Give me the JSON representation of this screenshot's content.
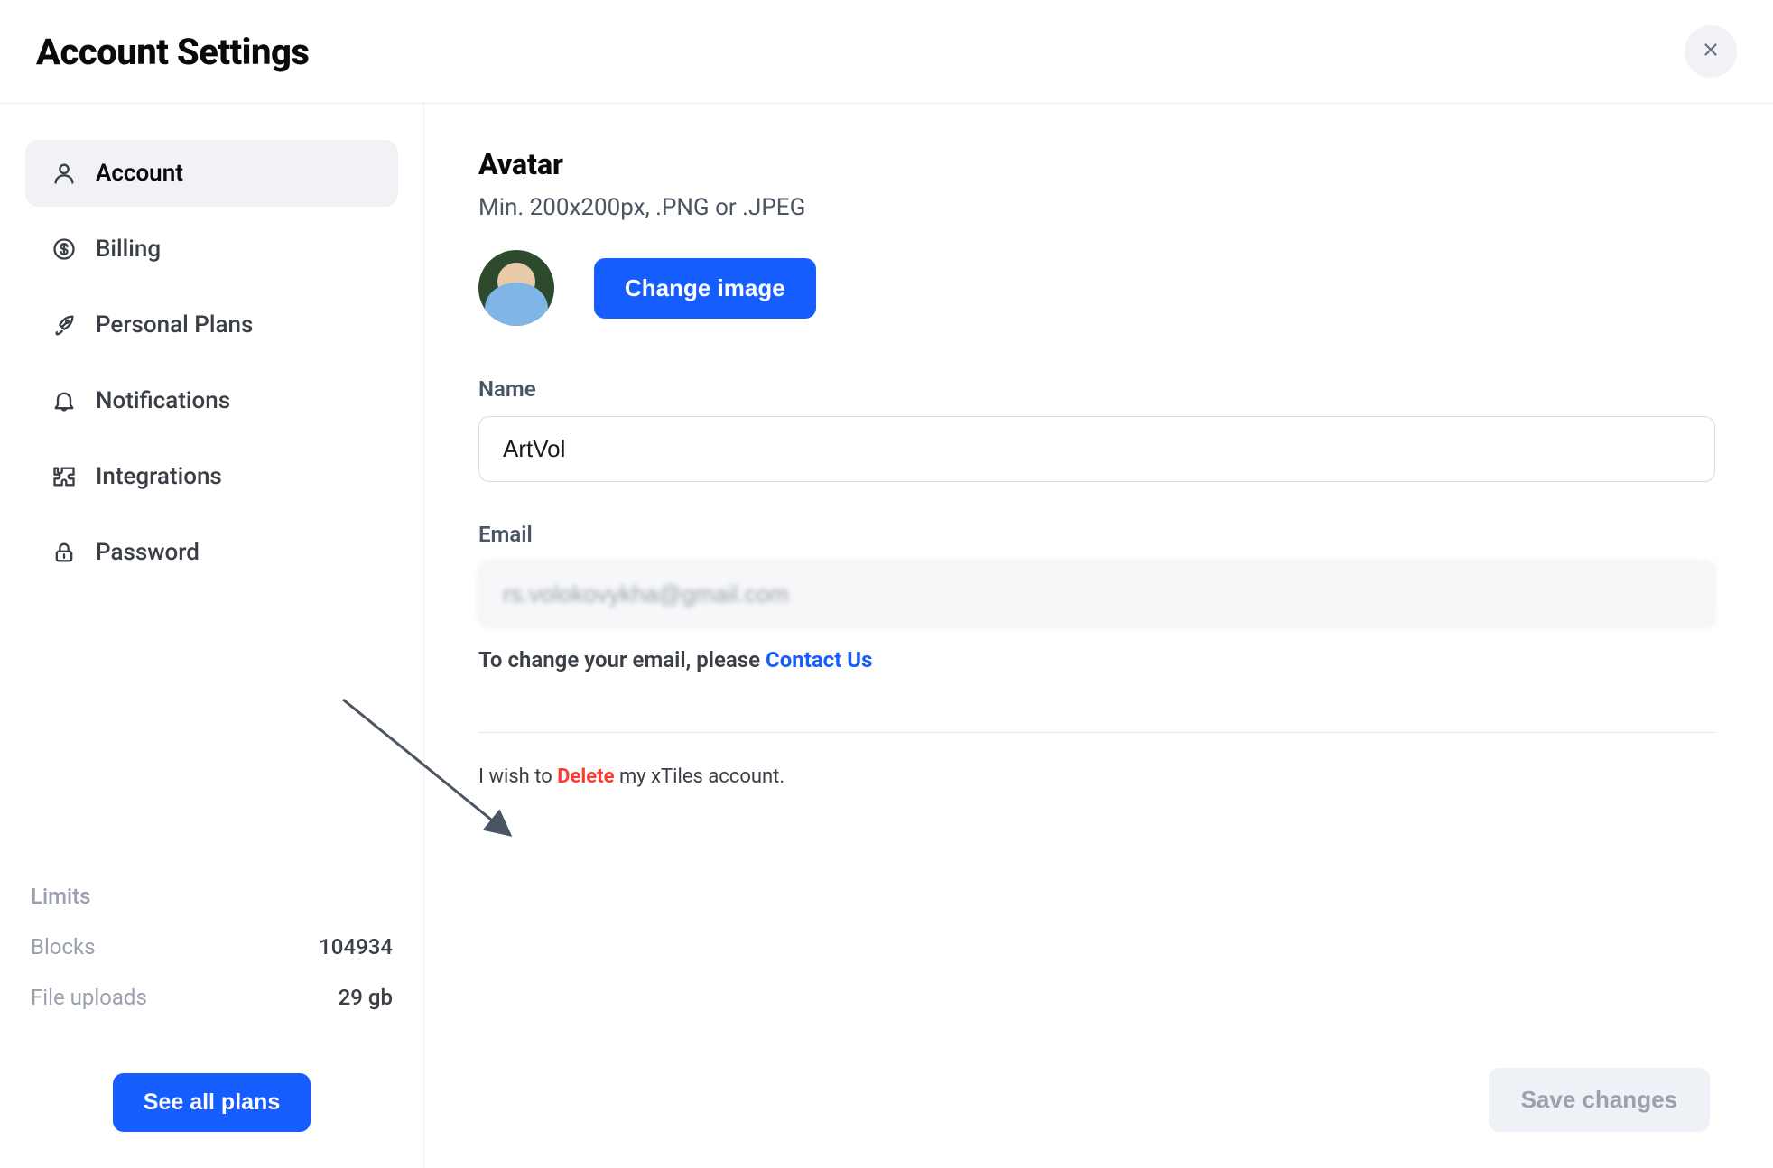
{
  "header": {
    "title": "Account Settings"
  },
  "sidebar": {
    "items": [
      {
        "label": "Account",
        "icon": "user-icon",
        "active": true
      },
      {
        "label": "Billing",
        "icon": "dollar-icon",
        "active": false
      },
      {
        "label": "Personal Plans",
        "icon": "rocket-icon",
        "active": false
      },
      {
        "label": "Notifications",
        "icon": "bell-icon",
        "active": false
      },
      {
        "label": "Integrations",
        "icon": "puzzle-icon",
        "active": false
      },
      {
        "label": "Password",
        "icon": "lock-icon",
        "active": false
      }
    ],
    "limits": {
      "title": "Limits",
      "rows": [
        {
          "label": "Blocks",
          "value": "104934"
        },
        {
          "label": "File uploads",
          "value": "29 gb"
        }
      ]
    },
    "cta_label": "See all plans"
  },
  "avatar": {
    "title": "Avatar",
    "subtitle": "Min. 200x200px, .PNG or .JPEG",
    "change_button": "Change image"
  },
  "name": {
    "label": "Name",
    "value": "ArtVol"
  },
  "email": {
    "label": "Email",
    "value": "rs.volokovykha@gmail.com",
    "hint_prefix": "To change your email, please ",
    "hint_link": "Contact Us"
  },
  "delete": {
    "prefix": "I wish to ",
    "action": "Delete",
    "suffix": " my xTiles account."
  },
  "save_label": "Save changes"
}
